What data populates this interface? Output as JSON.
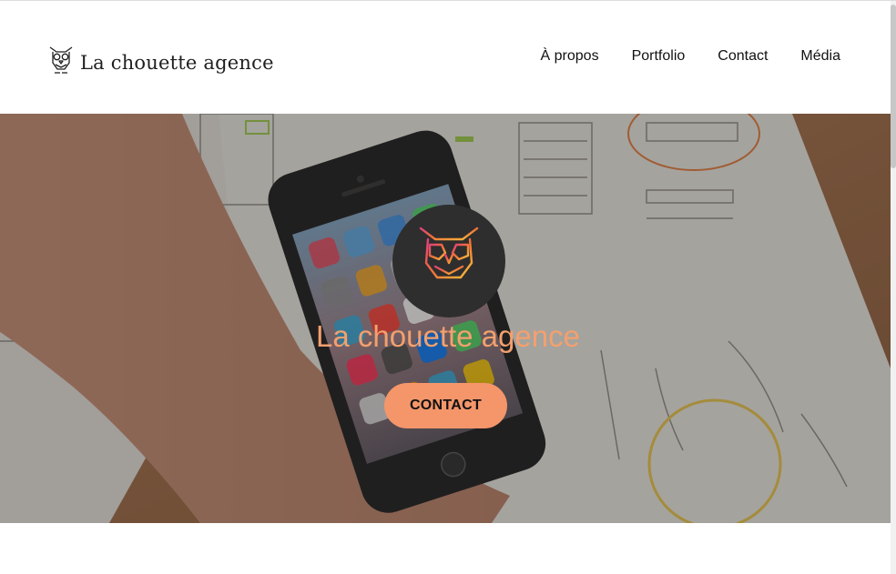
{
  "header": {
    "logo_text": "La chouette agence",
    "nav": [
      {
        "label": "À propos"
      },
      {
        "label": "Portfolio"
      },
      {
        "label": "Contact"
      },
      {
        "label": "Média"
      }
    ]
  },
  "hero": {
    "title": "La chouette agence",
    "cta_label": "CONTACT",
    "icon": "owl-logo-icon",
    "background_image": "photo-smartphone-wireframes"
  },
  "colors": {
    "accent": "#f4966a",
    "title": "#f3a06e",
    "badge_bg": "#2e2e2e",
    "text_dark": "#111111"
  }
}
